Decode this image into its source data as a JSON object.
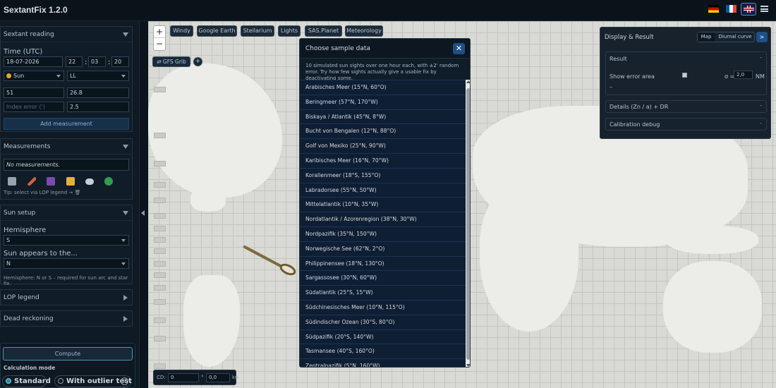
{
  "app": {
    "title": "SextantFix 1.2.0"
  },
  "sidebar": {
    "sextant_reading": {
      "title": "Sextant reading",
      "time_label": "Time (UTC)",
      "date": "18-07-2026",
      "hh": "22",
      "mm": "03",
      "ss": "20",
      "body": "Sun",
      "limb": "LL",
      "deg": "51",
      "min": "26.8",
      "index_error_placeholder": "Index error (')",
      "height": "2.5",
      "add_label": "Add measurement"
    },
    "measurements": {
      "title": "Measurements",
      "empty": "No measurements.",
      "tip": "Tip: select via LOP legend → 🗑"
    },
    "sun_setup": {
      "title": "Sun setup",
      "hemisphere_label": "Hemisphere",
      "hemisphere_value": "S",
      "appears_label": "Sun appears to the...",
      "appears_value": "N",
      "note": "Hemisphere: N or S – required for sun arc and star fix."
    },
    "lop_legend": {
      "title": "LOP legend"
    },
    "dead_reckoning": {
      "title": "Dead reckoning"
    },
    "compute": {
      "label": "Compute",
      "mode_label": "Calculation mode",
      "standard": "Standard",
      "outlier": "With outlier test",
      "help": "?"
    }
  },
  "map": {
    "zoom_in": "+",
    "zoom_out": "−",
    "layers": [
      "Windy",
      "Google Earth",
      "Stellarium",
      "Lights",
      "SAS.Planet",
      "Meteorology"
    ],
    "grib_label": "⇄ GFS Grib",
    "grib_add": "+",
    "cd_label": "CD:",
    "cd_value": "0",
    "cd_unit": "°",
    "dist_value": "0,0",
    "dist_unit": "kn"
  },
  "result_panel": {
    "title": "Display & Result",
    "tab_map": "Map",
    "tab_diurnal": "Diurnal curve",
    "go": ">",
    "result_title": "Result",
    "show_error_label": "Show error area",
    "sigma_label": "σ =",
    "sigma_value": "2,0",
    "sigma_unit": "NM",
    "dash": "–",
    "details_title": "Details (Zn / a) + DR",
    "calibration_title": "Calibration debug",
    "collapse_mark": "-"
  },
  "modal": {
    "title": "Choose sample data",
    "close": "✕",
    "description": "10 simulated sun sights over one hour each, with ±2' random error. Try how few sights actually give a usable fix by deactivating some.",
    "items": [
      "Arabisches Meer (15°N, 60°O)",
      "Beringmeer (57°N, 170°W)",
      "Biskaya / Atlantik (45°N, 8°W)",
      "Bucht von Bengalen (12°N, 88°O)",
      "Golf von Mexiko (25°N, 90°W)",
      "Karibisches Meer (16°N, 70°W)",
      "Korallenmeer (18°S, 155°O)",
      "Labradorsee (55°N, 50°W)",
      "Mittelatlantik (10°N, 35°W)",
      "Nordatlantik / Azorenregion (38°N, 30°W)",
      "Nordpazifik (35°N, 150°W)",
      "Norwegische See (62°N, 2°O)",
      "Philippinensee (18°N, 130°O)",
      "Sargassosee (30°N, 60°W)",
      "Südatlantik (25°S, 15°W)",
      "Südchinesisches Meer (10°N, 115°O)",
      "Südindischer Ozean (30°S, 80°O)",
      "Südpazifik (20°S, 140°W)",
      "Tasmansee (40°S, 160°O)",
      "Zentralpazifik (5°N, 160°W)"
    ]
  }
}
